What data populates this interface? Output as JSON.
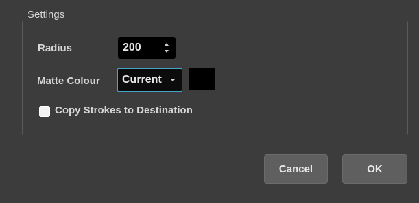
{
  "group": {
    "title": "Settings"
  },
  "radius": {
    "label": "Radius",
    "value": "200"
  },
  "matte": {
    "label": "Matte Colour",
    "selected": "Current",
    "swatch_color": "#000000"
  },
  "copy_strokes": {
    "label": "Copy Strokes to Destination",
    "checked": false
  },
  "buttons": {
    "cancel": "Cancel",
    "ok": "OK"
  }
}
